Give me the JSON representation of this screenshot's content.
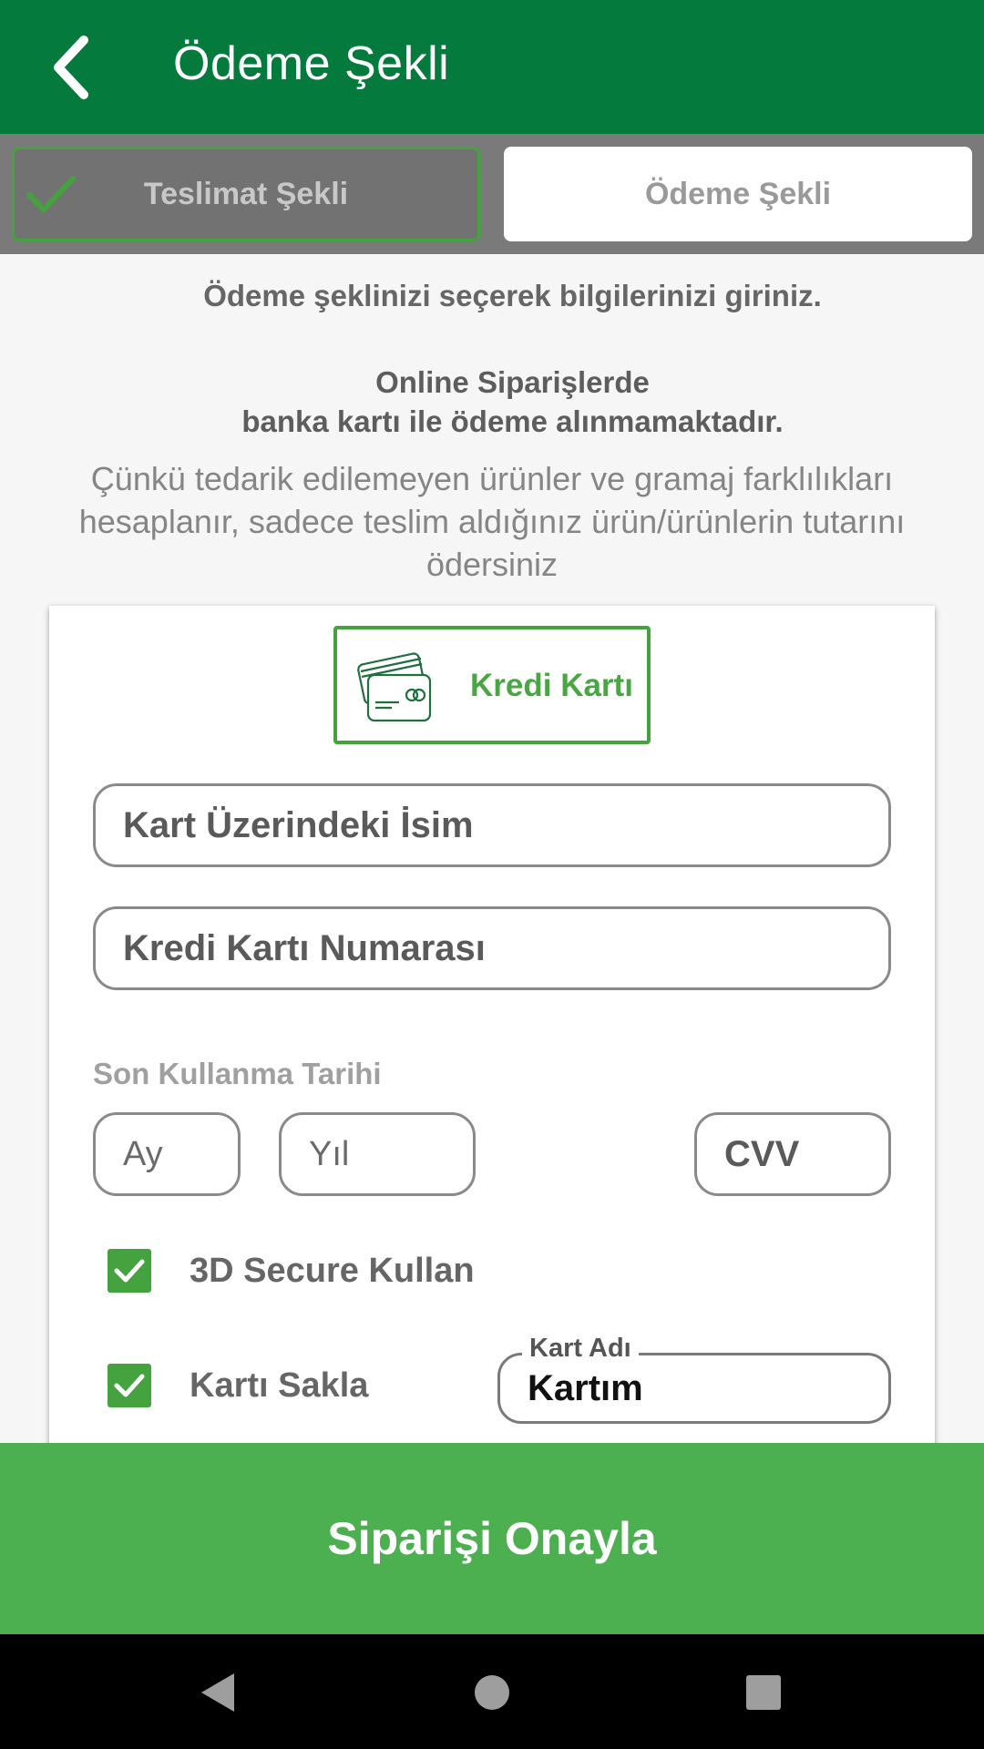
{
  "header": {
    "title": "Ödeme Şekli",
    "back_icon": "chevron-left-icon"
  },
  "steps": [
    {
      "label": "Teslimat Şekli",
      "completed": true
    },
    {
      "label": "Ödeme Şekli",
      "active": true
    }
  ],
  "info": {
    "instruction": "Ödeme şeklinizi seçerek bilgilerinizi giriniz.",
    "notice_line1": "Online Siparişlerde",
    "notice_line2": "banka kartı ile ödeme alınmamaktadır.",
    "explanation": "Çünkü tedarik edilemeyen ürünler ve gramaj farklılıkları hesaplanır, sadece teslim aldığınız ürün/ürünlerin tutarını ödersiniz"
  },
  "payment_method": {
    "label": "Kredi Kartı",
    "icon": "credit-card-icon"
  },
  "form": {
    "card_holder_placeholder": "Kart Üzerindeki İsim",
    "card_number_placeholder": "Kredi Kartı Numarası",
    "expiry_label": "Son Kullanma Tarihi",
    "month_placeholder": "Ay",
    "year_placeholder": "Yıl",
    "cvv_placeholder": "CVV",
    "secure_label": "3D Secure Kullan",
    "secure_checked": true,
    "save_card_label": "Kartı Sakla",
    "save_card_checked": true,
    "card_name_legend": "Kart Adı",
    "card_name_value": "Kartım"
  },
  "confirm": {
    "label": "Siparişi Onayla"
  },
  "colors": {
    "header": "#047b3c",
    "accent": "#45a33f",
    "confirm": "#4caf50"
  }
}
